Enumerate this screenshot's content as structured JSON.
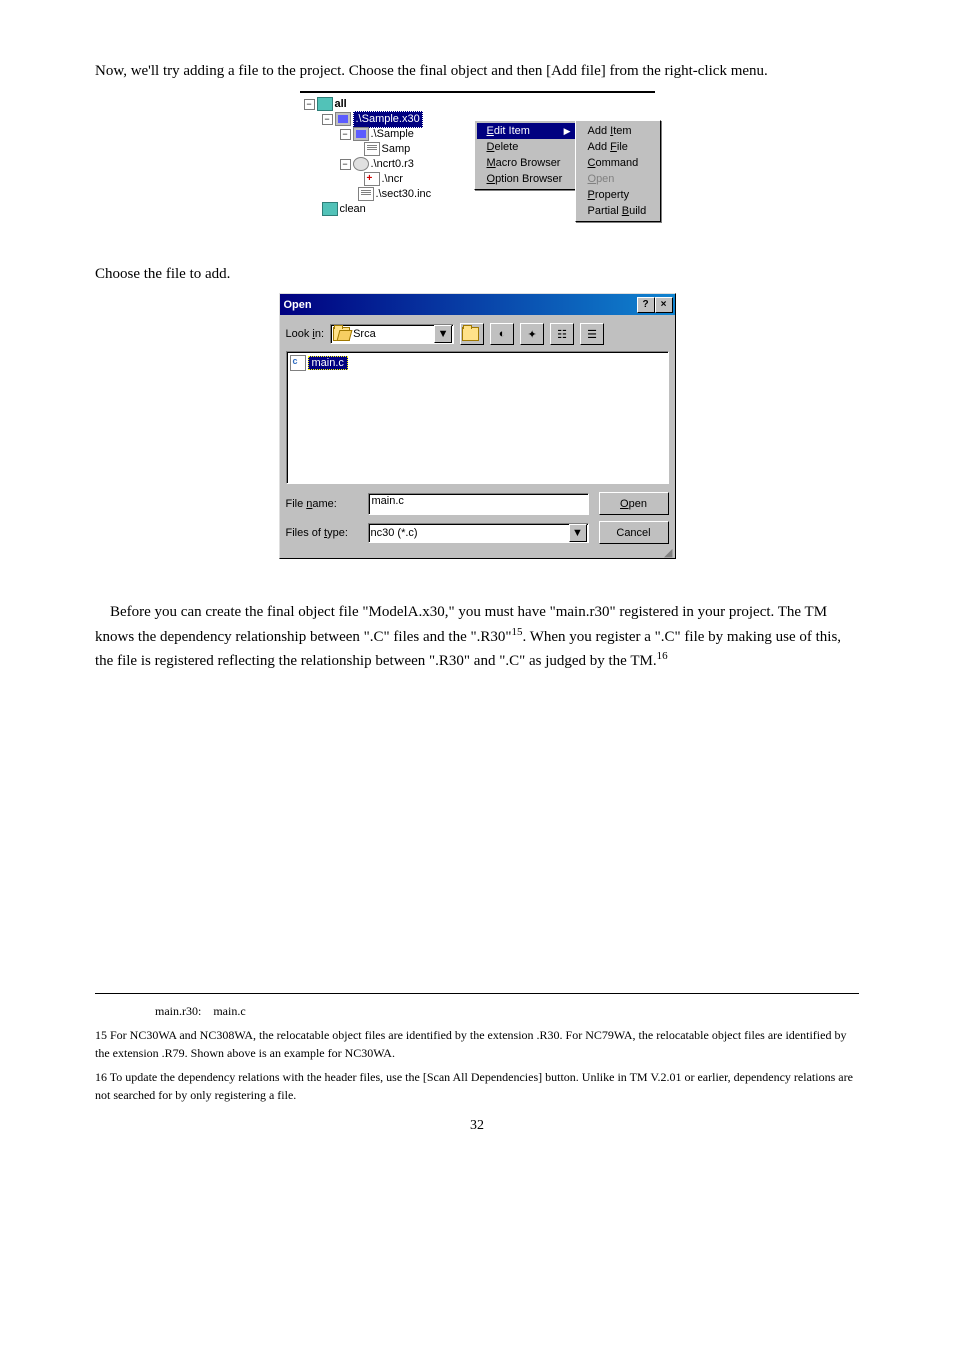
{
  "para1": "Now, we'll try adding a file to the project. Choose the final object and then [Add file] from the right-click menu.",
  "tree": {
    "root": "all",
    "n_selected": ".\\Sample.x30",
    "n_sample": ".\\Sample",
    "n_samp": "Samp",
    "n_ncrt0r3": ".\\ncrt0.r3",
    "n_ncr": ".\\ncr",
    "n_sect30": ".\\sect30.inc",
    "n_clean": "clean"
  },
  "menu1": {
    "edit_item": "Edit Item",
    "delete": "Delete",
    "macro_browser": "Macro Browser",
    "option_browser": "Option Browser"
  },
  "menu2": {
    "add_item": "Add Item",
    "add_file": "Add File",
    "command": "Command",
    "open": "Open",
    "property": "Property",
    "partial_build": "Partial Build"
  },
  "para2": "Choose the file to add.",
  "dialog": {
    "title": "Open",
    "help_btn": "?",
    "close_btn": "×",
    "look_in_label_pre": "Look ",
    "look_in_label_u": "i",
    "look_in_label_post": "n:",
    "look_in_value": "Srca",
    "file_selected": "main.c",
    "file_name_label_pre": "File ",
    "file_name_label_u": "n",
    "file_name_label_post": "ame:",
    "file_name_value": "main.c",
    "file_type_label_pre": "Files of ",
    "file_type_label_u": "t",
    "file_type_label_post": "ype:",
    "file_type_value": "nc30 (*.c)",
    "open_btn_u": "O",
    "open_btn_post": "pen",
    "cancel_btn": "Cancel",
    "toolbar_icons": [
      "▼",
      "⇧",
      "⌀",
      "✦",
      "▦",
      "▤"
    ]
  },
  "para3_a": "Before you can create the final object file \"ModelA.x30,\" you must have \"main.r30\" registered in your project. The TM knows the dependency relationship between \".C\" files and the \".R30\"",
  "para3_sup1": "15",
  "para3_b": ". When you register a \".C\" file by making use of this, the file is registered reflecting the relationship between \".R30\" and \".C\" as judged by the TM.",
  "para3_sup2": "16",
  "fn_caption": "main.r30: main.c",
  "fn15_num": "15",
  "fn15": " For NC30WA and NC308WA, the relocatable object files are identified by the extension  .R30.  For NC79WA, the relocatable object files are identified by the extension  .R79.  Shown above is an example for NC30WA.",
  "fn16_num": "16",
  "fn16": " To update the dependency relations with the header files, use the [Scan All Dependencies] button. Unlike in TM V.2.01 or earlier, dependency relations are not searched for by only registering a file.",
  "page_number": "32"
}
